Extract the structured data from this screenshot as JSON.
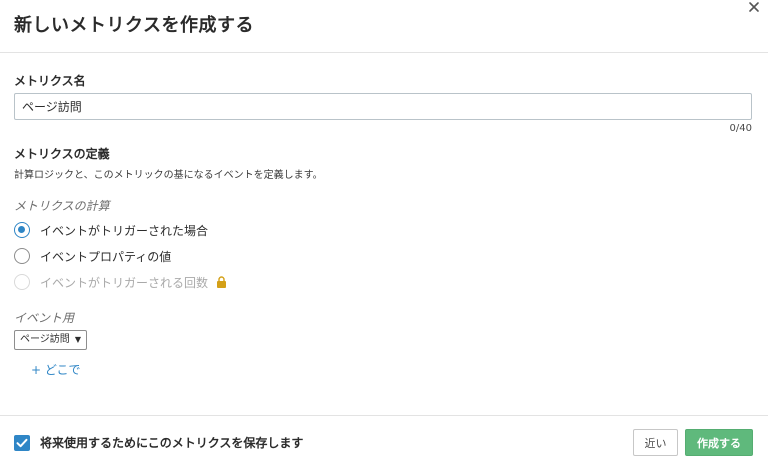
{
  "dialog": {
    "title": "新しいメトリクスを作成する",
    "close_icon": "close-icon"
  },
  "name_field": {
    "label": "メトリクス名",
    "value": "ページ訪問",
    "counter": "0/40"
  },
  "definition": {
    "label": "メトリクスの定義",
    "description": "計算ロジックと、このメトリックの基になるイベントを定義します。"
  },
  "calculation": {
    "label": "メトリクスの計算",
    "options": [
      {
        "label": "イベントがトリガーされた場合",
        "selected": true,
        "disabled": false
      },
      {
        "label": "イベントプロパティの値",
        "selected": false,
        "disabled": false
      },
      {
        "label": "イベントがトリガーされる回数",
        "selected": false,
        "disabled": true,
        "icon": "lock-icon"
      }
    ]
  },
  "event": {
    "label": "イベント用",
    "selected": "ページ訪問",
    "add_where": "+ どこで"
  },
  "footer": {
    "save_checkbox_label": "将来使用するためにこのメトリクスを保存します",
    "save_checked": true,
    "close_button": "近い",
    "create_button": "作成する"
  },
  "colors": {
    "accent": "#2f86c6",
    "primary_button": "#5fb97c",
    "lock": "#d4a017"
  }
}
